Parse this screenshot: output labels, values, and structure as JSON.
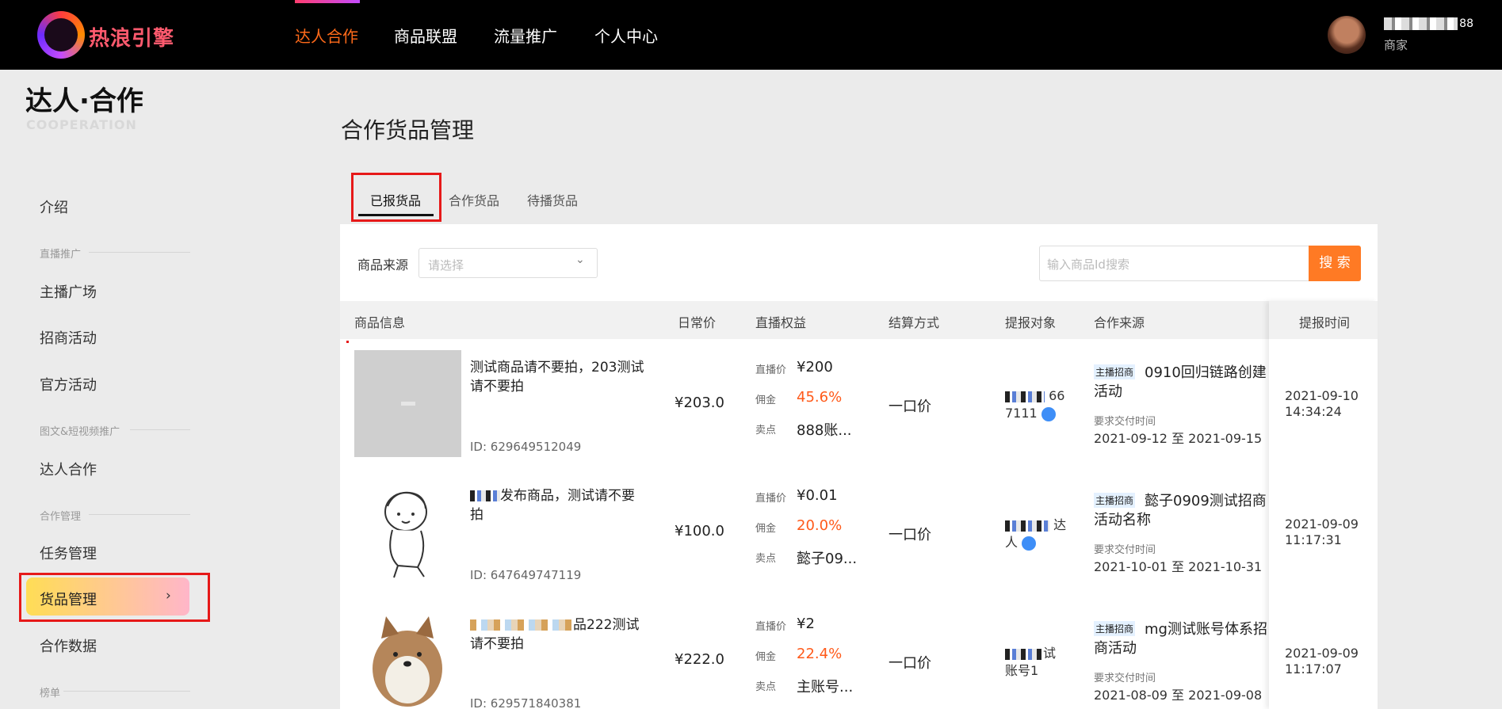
{
  "header": {
    "logo_text": "热浪引擎",
    "nav": [
      "达人合作",
      "商品联盟",
      "流量推广",
      "个人中心"
    ],
    "user_name_visible": "88",
    "user_role": "商家"
  },
  "sidebar": {
    "title": "达人·合作",
    "subtitle": "COOPERATION",
    "intro": "介绍",
    "groups": [
      {
        "label": "直播推广",
        "items": [
          "主播广场",
          "招商活动",
          "官方活动"
        ]
      },
      {
        "label": "图文&短视频推广",
        "items": [
          "达人合作"
        ]
      },
      {
        "label": "合作管理",
        "items": [
          "任务管理",
          "货品管理",
          "合作数据"
        ]
      },
      {
        "label": "榜单",
        "items": []
      }
    ],
    "active_item": "货品管理",
    "chevron": "›"
  },
  "main": {
    "title": "合作货品管理",
    "tabs": [
      "已报货品",
      "合作货品",
      "待播货品"
    ],
    "active_tab": "已报货品",
    "filter_label": "商品来源",
    "select_placeholder": "请选择",
    "search_placeholder": "输入商品Id搜索",
    "search_button": "搜 索",
    "columns": [
      "商品信息",
      "日常价",
      "直播权益",
      "结算方式",
      "提报对象",
      "合作来源",
      "提报时间"
    ],
    "benefit_labels": {
      "live_price": "直播价",
      "commission": "佣金",
      "selling_point": "卖点"
    },
    "req_label": "要求交付时间",
    "rows": [
      {
        "name": "测试商品请不要拍，203测试请不要拍",
        "id": "ID: 629649512049",
        "price": "¥203.0",
        "live_price": "¥200",
        "commission": "45.6%",
        "selling_point": "888账...",
        "settlement": "一口价",
        "target": "66 7111",
        "source_tag": "主播招商",
        "source_title": "0910回归链路创建活动",
        "req_range": "2021-09-12 至 2021-09-15",
        "time": "2021-09-10 14:34:24"
      },
      {
        "name": "发布商品，测试请不要拍",
        "id": "ID: 647649747119",
        "price": "¥100.0",
        "live_price": "¥0.01",
        "commission": "20.0%",
        "selling_point": "懿子09...",
        "settlement": "一口价",
        "target": "达人",
        "source_tag": "主播招商",
        "source_title": "懿子0909测试招商活动名称",
        "req_range": "2021-10-01 至 2021-10-31",
        "time": "2021-09-09 11:17:31"
      },
      {
        "name": "品222测试请不要拍",
        "id": "ID: 629571840381",
        "price": "¥222.0",
        "live_price": "¥2",
        "commission": "22.4%",
        "selling_point": "主账号...",
        "settlement": "一口价",
        "target": "试 账号1",
        "source_tag": "主播招商",
        "source_title": "mg测试账号体系招商活动",
        "req_range": "2021-08-09 至 2021-09-08",
        "time": "2021-09-09 11:17:07"
      }
    ]
  },
  "colors": {
    "accent": "#ff7a24",
    "highlight_red": "#e61919",
    "commission": "#ff5a1a"
  }
}
